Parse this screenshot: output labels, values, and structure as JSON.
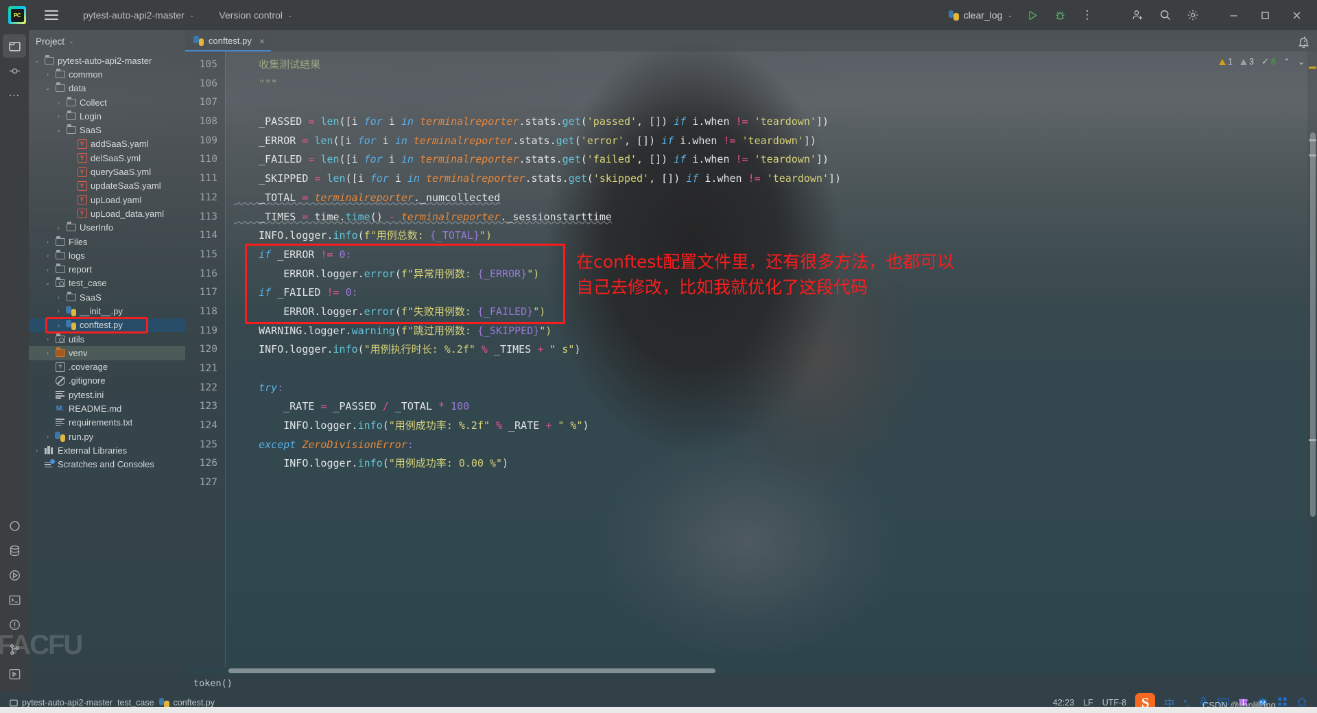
{
  "titlebar": {
    "logo_alt": "PC",
    "project_name": "pytest-auto-api2-master",
    "version_control": "Version control",
    "run_config": "clear_log",
    "chevron": "⌄",
    "more": "⋮"
  },
  "toolstrip": {
    "items": [
      {
        "name": "project-tool",
        "glyph": "▢"
      },
      {
        "name": "commit-tool",
        "glyph": "⌸"
      },
      {
        "name": "more-tool",
        "glyph": "⋯"
      },
      {
        "name": "python-packages-tool",
        "glyph": "◑"
      },
      {
        "name": "database-tool",
        "glyph": "⛁"
      },
      {
        "name": "run-tool",
        "glyph": "▷"
      },
      {
        "name": "terminal-tool",
        "glyph": "▣"
      },
      {
        "name": "problems-tool",
        "glyph": "!"
      },
      {
        "name": "git-tool",
        "glyph": "⑂"
      },
      {
        "name": "services-tool",
        "glyph": "▷"
      }
    ],
    "watermark": "FACFU"
  },
  "project_panel": {
    "title": "Project",
    "chevron": "⌄",
    "tree": [
      {
        "depth": 0,
        "arrow": "⌄",
        "icon": "folder",
        "label": "pytest-auto-api2-master"
      },
      {
        "depth": 1,
        "arrow": "›",
        "icon": "folder",
        "label": "common"
      },
      {
        "depth": 1,
        "arrow": "⌄",
        "icon": "folder",
        "label": "data"
      },
      {
        "depth": 2,
        "arrow": "›",
        "icon": "folder",
        "label": "Collect"
      },
      {
        "depth": 2,
        "arrow": "›",
        "icon": "folder",
        "label": "Login"
      },
      {
        "depth": 2,
        "arrow": "⌄",
        "icon": "folder",
        "label": "SaaS"
      },
      {
        "depth": 3,
        "arrow": "",
        "icon": "yaml",
        "label": "addSaaS.yaml"
      },
      {
        "depth": 3,
        "arrow": "",
        "icon": "yaml",
        "label": "delSaaS.yml"
      },
      {
        "depth": 3,
        "arrow": "",
        "icon": "yaml",
        "label": "querySaaS.yml"
      },
      {
        "depth": 3,
        "arrow": "",
        "icon": "yaml",
        "label": "updateSaaS.yaml"
      },
      {
        "depth": 3,
        "arrow": "",
        "icon": "yaml",
        "label": "upLoad.yaml"
      },
      {
        "depth": 3,
        "arrow": "",
        "icon": "yaml",
        "label": "upLoad_data.yaml"
      },
      {
        "depth": 2,
        "arrow": "›",
        "icon": "folder",
        "label": "UserInfo"
      },
      {
        "depth": 1,
        "arrow": "›",
        "icon": "folder",
        "label": "Files"
      },
      {
        "depth": 1,
        "arrow": "›",
        "icon": "folder",
        "label": "logs"
      },
      {
        "depth": 1,
        "arrow": "›",
        "icon": "folder",
        "label": "report"
      },
      {
        "depth": 1,
        "arrow": "⌄",
        "icon": "folder-source",
        "label": "test_case"
      },
      {
        "depth": 2,
        "arrow": "›",
        "icon": "folder",
        "label": "SaaS"
      },
      {
        "depth": 2,
        "arrow": "›",
        "icon": "python",
        "label": "__init__.py"
      },
      {
        "depth": 2,
        "arrow": "›",
        "icon": "python",
        "label": "conftest.py",
        "selected": true
      },
      {
        "depth": 1,
        "arrow": "›",
        "icon": "folder-source",
        "label": "utils"
      },
      {
        "depth": 1,
        "arrow": "›",
        "icon": "folder-excluded",
        "label": "venv",
        "excluded": true
      },
      {
        "depth": 1,
        "arrow": "",
        "icon": "unknown",
        "label": ".coverage"
      },
      {
        "depth": 1,
        "arrow": "",
        "icon": "ignored",
        "label": ".gitignore"
      },
      {
        "depth": 1,
        "arrow": "",
        "icon": "text",
        "label": "pytest.ini"
      },
      {
        "depth": 1,
        "arrow": "",
        "icon": "markdown",
        "label": "README.md"
      },
      {
        "depth": 1,
        "arrow": "",
        "icon": "text",
        "label": "requirements.txt"
      },
      {
        "depth": 1,
        "arrow": "›",
        "icon": "python",
        "label": "run.py"
      },
      {
        "depth": 0,
        "arrow": "›",
        "icon": "library",
        "label": "External Libraries"
      },
      {
        "depth": 0,
        "arrow": "",
        "icon": "scratches",
        "label": "Scratches and Consoles"
      }
    ]
  },
  "editor": {
    "tabs": [
      {
        "label": "conftest.py",
        "icon": "python-file-icon",
        "active": true,
        "close": "×"
      }
    ],
    "tab_more": "⋮",
    "inspection": {
      "warn_count": "1",
      "weak_count": "3",
      "ok_count": "8",
      "up": "⌃",
      "down": "⌄",
      "check": "✓"
    },
    "first_line_number": 105,
    "lines": [
      {
        "n": 105,
        "tokens": [
          {
            "t": "    收集测试结果",
            "c": "doc"
          }
        ]
      },
      {
        "n": 106,
        "tokens": [
          {
            "t": "    \"\"\"",
            "c": "doc"
          }
        ]
      },
      {
        "n": 107,
        "tokens": [
          {
            "t": "",
            "c": "var"
          }
        ]
      },
      {
        "n": 108,
        "tokens": [
          {
            "t": "    _PASSED ",
            "c": "var"
          },
          {
            "t": "= ",
            "c": "op"
          },
          {
            "t": "len",
            "c": "fn"
          },
          {
            "t": "([i ",
            "c": "var"
          },
          {
            "t": "for ",
            "c": "kw"
          },
          {
            "t": "i ",
            "c": "var"
          },
          {
            "t": "in ",
            "c": "kw"
          },
          {
            "t": "terminalreporter",
            "c": "obj"
          },
          {
            "t": ".stats.",
            "c": "var"
          },
          {
            "t": "get",
            "c": "fn"
          },
          {
            "t": "(",
            "c": "var"
          },
          {
            "t": "'passed'",
            "c": "str"
          },
          {
            "t": ", []) ",
            "c": "var"
          },
          {
            "t": "if ",
            "c": "kw"
          },
          {
            "t": "i.when ",
            "c": "var"
          },
          {
            "t": "!= ",
            "c": "op"
          },
          {
            "t": "'teardown'",
            "c": "str"
          },
          {
            "t": "])",
            "c": "var"
          }
        ]
      },
      {
        "n": 109,
        "tokens": [
          {
            "t": "    _ERROR ",
            "c": "var"
          },
          {
            "t": "= ",
            "c": "op"
          },
          {
            "t": "len",
            "c": "fn"
          },
          {
            "t": "([i ",
            "c": "var"
          },
          {
            "t": "for ",
            "c": "kw"
          },
          {
            "t": "i ",
            "c": "var"
          },
          {
            "t": "in ",
            "c": "kw"
          },
          {
            "t": "terminalreporter",
            "c": "obj"
          },
          {
            "t": ".stats.",
            "c": "var"
          },
          {
            "t": "get",
            "c": "fn"
          },
          {
            "t": "(",
            "c": "var"
          },
          {
            "t": "'error'",
            "c": "str"
          },
          {
            "t": ", []) ",
            "c": "var"
          },
          {
            "t": "if ",
            "c": "kw"
          },
          {
            "t": "i.when ",
            "c": "var"
          },
          {
            "t": "!= ",
            "c": "op"
          },
          {
            "t": "'teardown'",
            "c": "str"
          },
          {
            "t": "])",
            "c": "var"
          }
        ]
      },
      {
        "n": 110,
        "tokens": [
          {
            "t": "    _FAILED ",
            "c": "var"
          },
          {
            "t": "= ",
            "c": "op"
          },
          {
            "t": "len",
            "c": "fn"
          },
          {
            "t": "([i ",
            "c": "var"
          },
          {
            "t": "for ",
            "c": "kw"
          },
          {
            "t": "i ",
            "c": "var"
          },
          {
            "t": "in ",
            "c": "kw"
          },
          {
            "t": "terminalreporter",
            "c": "obj"
          },
          {
            "t": ".stats.",
            "c": "var"
          },
          {
            "t": "get",
            "c": "fn"
          },
          {
            "t": "(",
            "c": "var"
          },
          {
            "t": "'failed'",
            "c": "str"
          },
          {
            "t": ", []) ",
            "c": "var"
          },
          {
            "t": "if ",
            "c": "kw"
          },
          {
            "t": "i.when ",
            "c": "var"
          },
          {
            "t": "!= ",
            "c": "op"
          },
          {
            "t": "'teardown'",
            "c": "str"
          },
          {
            "t": "])",
            "c": "var"
          }
        ]
      },
      {
        "n": 111,
        "tokens": [
          {
            "t": "    _SKIPPED ",
            "c": "var"
          },
          {
            "t": "= ",
            "c": "op"
          },
          {
            "t": "len",
            "c": "fn"
          },
          {
            "t": "([i ",
            "c": "var"
          },
          {
            "t": "for ",
            "c": "kw"
          },
          {
            "t": "i ",
            "c": "var"
          },
          {
            "t": "in ",
            "c": "kw"
          },
          {
            "t": "terminalreporter",
            "c": "obj"
          },
          {
            "t": ".stats.",
            "c": "var"
          },
          {
            "t": "get",
            "c": "fn"
          },
          {
            "t": "(",
            "c": "var"
          },
          {
            "t": "'skipped'",
            "c": "str"
          },
          {
            "t": ", []) ",
            "c": "var"
          },
          {
            "t": "if ",
            "c": "kw"
          },
          {
            "t": "i.when ",
            "c": "var"
          },
          {
            "t": "!= ",
            "c": "op"
          },
          {
            "t": "'teardown'",
            "c": "str"
          },
          {
            "t": "])",
            "c": "var"
          }
        ]
      },
      {
        "n": 112,
        "tokens": [
          {
            "t": "    _TOTAL ",
            "c": "var"
          },
          {
            "t": "= ",
            "c": "op"
          },
          {
            "t": "terminalreporter",
            "c": "obj"
          },
          {
            "t": "._numcollected",
            "c": "var"
          }
        ]
      },
      {
        "n": 113,
        "tokens": [
          {
            "t": "    _TIMES ",
            "c": "var"
          },
          {
            "t": "= ",
            "c": "op"
          },
          {
            "t": "time.",
            "c": "var"
          },
          {
            "t": "time",
            "c": "fn"
          },
          {
            "t": "() ",
            "c": "var"
          },
          {
            "t": "- ",
            "c": "op"
          },
          {
            "t": "terminalreporter",
            "c": "obj"
          },
          {
            "t": "._sessionstarttime",
            "c": "var"
          }
        ]
      },
      {
        "n": 114,
        "tokens": [
          {
            "t": "    INFO.logger.",
            "c": "var"
          },
          {
            "t": "info",
            "c": "fn"
          },
          {
            "t": "(",
            "c": "var"
          },
          {
            "t": "f\"用例总数: ",
            "c": "str"
          },
          {
            "t": "{_TOTAL}",
            "c": "brc"
          },
          {
            "t": "\")",
            "c": "str"
          }
        ]
      },
      {
        "n": 115,
        "tokens": [
          {
            "t": "    ",
            "c": "var"
          },
          {
            "t": "if ",
            "c": "kw"
          },
          {
            "t": "_ERROR ",
            "c": "var"
          },
          {
            "t": "!= ",
            "c": "op"
          },
          {
            "t": "0",
            "c": "num"
          },
          {
            "t": ":",
            "c": "brc"
          }
        ]
      },
      {
        "n": 116,
        "tokens": [
          {
            "t": "        ERROR.logger.",
            "c": "var"
          },
          {
            "t": "error",
            "c": "fn"
          },
          {
            "t": "(",
            "c": "var"
          },
          {
            "t": "f\"异常用例数: ",
            "c": "str"
          },
          {
            "t": "{_ERROR}",
            "c": "brc"
          },
          {
            "t": "\")",
            "c": "str"
          }
        ]
      },
      {
        "n": 117,
        "tokens": [
          {
            "t": "    ",
            "c": "var"
          },
          {
            "t": "if ",
            "c": "kw"
          },
          {
            "t": "_FAILED ",
            "c": "var"
          },
          {
            "t": "!= ",
            "c": "op"
          },
          {
            "t": "0",
            "c": "num"
          },
          {
            "t": ":",
            "c": "brc"
          }
        ]
      },
      {
        "n": 118,
        "tokens": [
          {
            "t": "        ERROR.logger.",
            "c": "var"
          },
          {
            "t": "error",
            "c": "fn"
          },
          {
            "t": "(",
            "c": "var"
          },
          {
            "t": "f\"失败用例数: ",
            "c": "str"
          },
          {
            "t": "{_FAILED}",
            "c": "brc"
          },
          {
            "t": "\")",
            "c": "str"
          }
        ]
      },
      {
        "n": 119,
        "tokens": [
          {
            "t": "    WARNING.logger.",
            "c": "var"
          },
          {
            "t": "warning",
            "c": "fn"
          },
          {
            "t": "(",
            "c": "var"
          },
          {
            "t": "f\"跳过用例数: ",
            "c": "str"
          },
          {
            "t": "{_SKIPPED}",
            "c": "brc"
          },
          {
            "t": "\")",
            "c": "str"
          }
        ]
      },
      {
        "n": 120,
        "tokens": [
          {
            "t": "    INFO.logger.",
            "c": "var"
          },
          {
            "t": "info",
            "c": "fn"
          },
          {
            "t": "(",
            "c": "var"
          },
          {
            "t": "\"用例执行时长: %.2f\"",
            "c": "str"
          },
          {
            "t": " % ",
            "c": "op"
          },
          {
            "t": "_TIMES ",
            "c": "var"
          },
          {
            "t": "+ ",
            "c": "op"
          },
          {
            "t": "\" s\"",
            "c": "str"
          },
          {
            "t": ")",
            "c": "var"
          }
        ]
      },
      {
        "n": 121,
        "tokens": [
          {
            "t": "",
            "c": "var"
          }
        ]
      },
      {
        "n": 122,
        "tokens": [
          {
            "t": "    ",
            "c": "var"
          },
          {
            "t": "try",
            "c": "kw"
          },
          {
            "t": ":",
            "c": "brc"
          }
        ]
      },
      {
        "n": 123,
        "tokens": [
          {
            "t": "        _RATE ",
            "c": "var"
          },
          {
            "t": "= ",
            "c": "op"
          },
          {
            "t": "_PASSED ",
            "c": "var"
          },
          {
            "t": "/ ",
            "c": "op"
          },
          {
            "t": "_TOTAL ",
            "c": "var"
          },
          {
            "t": "* ",
            "c": "op"
          },
          {
            "t": "100",
            "c": "num"
          }
        ]
      },
      {
        "n": 124,
        "tokens": [
          {
            "t": "        INFO.logger.",
            "c": "var"
          },
          {
            "t": "info",
            "c": "fn"
          },
          {
            "t": "(",
            "c": "var"
          },
          {
            "t": "\"用例成功率: %.2f\"",
            "c": "str"
          },
          {
            "t": " % ",
            "c": "op"
          },
          {
            "t": "_RATE ",
            "c": "var"
          },
          {
            "t": "+ ",
            "c": "op"
          },
          {
            "t": "\" %\"",
            "c": "str"
          },
          {
            "t": ")",
            "c": "var"
          }
        ]
      },
      {
        "n": 125,
        "tokens": [
          {
            "t": "    ",
            "c": "var"
          },
          {
            "t": "except ",
            "c": "kw"
          },
          {
            "t": "ZeroDivisionError",
            "c": "obj"
          },
          {
            "t": ":",
            "c": "brc"
          }
        ]
      },
      {
        "n": 126,
        "tokens": [
          {
            "t": "        INFO.logger.",
            "c": "var"
          },
          {
            "t": "info",
            "c": "fn"
          },
          {
            "t": "(",
            "c": "var"
          },
          {
            "t": "\"用例成功率: 0.00 %\"",
            "c": "str"
          },
          {
            "t": ")",
            "c": "var"
          }
        ]
      },
      {
        "n": 127,
        "tokens": [
          {
            "t": "",
            "c": "var"
          }
        ]
      }
    ],
    "breadcrumb": "token()"
  },
  "annotation": {
    "text_line1": "在conftest配置文件里，还有很多方法，也都可以",
    "text_line2": "自己去修改，比如我就优化了这段代码",
    "color": "#fb1d1d"
  },
  "statusbar": {
    "crumbs": [
      "pytest-auto-api2-master",
      "test_case",
      "conftest.py"
    ],
    "position": "42:23",
    "line_sep": "LF",
    "encoding": "UTF-8",
    "ime": {
      "sogou": "S",
      "lang": "中",
      "punct": "°,",
      "mic": "🎤",
      "kbd": "⌨",
      "gift": "🎁",
      "robot": "🤖",
      "apps": "▦",
      "home": "⌂"
    },
    "watermark": "CSDN @lianliliang"
  }
}
